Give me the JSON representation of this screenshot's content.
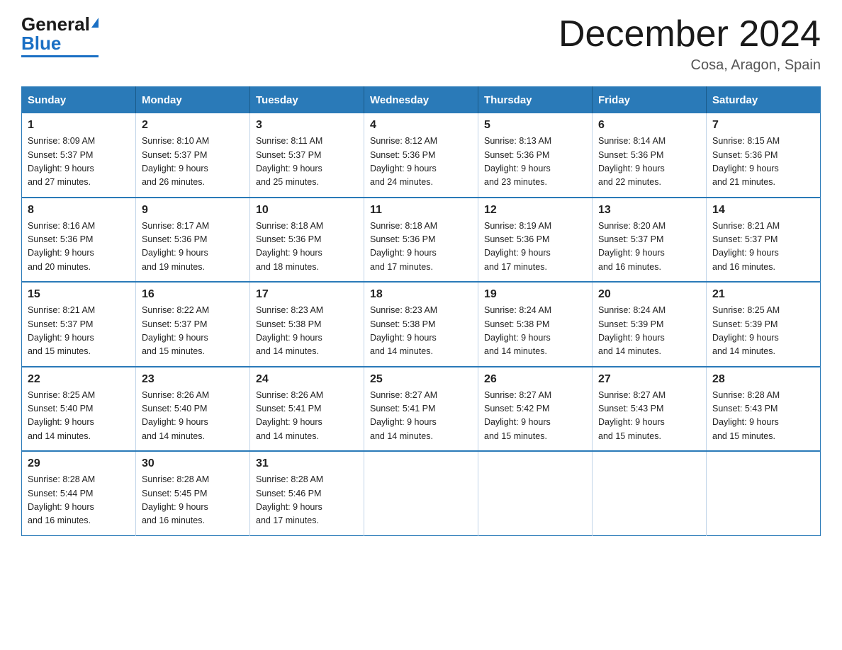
{
  "logo": {
    "general": "General",
    "blue": "Blue"
  },
  "title": "December 2024",
  "location": "Cosa, Aragon, Spain",
  "days_of_week": [
    "Sunday",
    "Monday",
    "Tuesday",
    "Wednesday",
    "Thursday",
    "Friday",
    "Saturday"
  ],
  "weeks": [
    [
      {
        "day": "1",
        "sunrise": "8:09 AM",
        "sunset": "5:37 PM",
        "daylight": "9 hours and 27 minutes."
      },
      {
        "day": "2",
        "sunrise": "8:10 AM",
        "sunset": "5:37 PM",
        "daylight": "9 hours and 26 minutes."
      },
      {
        "day": "3",
        "sunrise": "8:11 AM",
        "sunset": "5:37 PM",
        "daylight": "9 hours and 25 minutes."
      },
      {
        "day": "4",
        "sunrise": "8:12 AM",
        "sunset": "5:36 PM",
        "daylight": "9 hours and 24 minutes."
      },
      {
        "day": "5",
        "sunrise": "8:13 AM",
        "sunset": "5:36 PM",
        "daylight": "9 hours and 23 minutes."
      },
      {
        "day": "6",
        "sunrise": "8:14 AM",
        "sunset": "5:36 PM",
        "daylight": "9 hours and 22 minutes."
      },
      {
        "day": "7",
        "sunrise": "8:15 AM",
        "sunset": "5:36 PM",
        "daylight": "9 hours and 21 minutes."
      }
    ],
    [
      {
        "day": "8",
        "sunrise": "8:16 AM",
        "sunset": "5:36 PM",
        "daylight": "9 hours and 20 minutes."
      },
      {
        "day": "9",
        "sunrise": "8:17 AM",
        "sunset": "5:36 PM",
        "daylight": "9 hours and 19 minutes."
      },
      {
        "day": "10",
        "sunrise": "8:18 AM",
        "sunset": "5:36 PM",
        "daylight": "9 hours and 18 minutes."
      },
      {
        "day": "11",
        "sunrise": "8:18 AM",
        "sunset": "5:36 PM",
        "daylight": "9 hours and 17 minutes."
      },
      {
        "day": "12",
        "sunrise": "8:19 AM",
        "sunset": "5:36 PM",
        "daylight": "9 hours and 17 minutes."
      },
      {
        "day": "13",
        "sunrise": "8:20 AM",
        "sunset": "5:37 PM",
        "daylight": "9 hours and 16 minutes."
      },
      {
        "day": "14",
        "sunrise": "8:21 AM",
        "sunset": "5:37 PM",
        "daylight": "9 hours and 16 minutes."
      }
    ],
    [
      {
        "day": "15",
        "sunrise": "8:21 AM",
        "sunset": "5:37 PM",
        "daylight": "9 hours and 15 minutes."
      },
      {
        "day": "16",
        "sunrise": "8:22 AM",
        "sunset": "5:37 PM",
        "daylight": "9 hours and 15 minutes."
      },
      {
        "day": "17",
        "sunrise": "8:23 AM",
        "sunset": "5:38 PM",
        "daylight": "9 hours and 14 minutes."
      },
      {
        "day": "18",
        "sunrise": "8:23 AM",
        "sunset": "5:38 PM",
        "daylight": "9 hours and 14 minutes."
      },
      {
        "day": "19",
        "sunrise": "8:24 AM",
        "sunset": "5:38 PM",
        "daylight": "9 hours and 14 minutes."
      },
      {
        "day": "20",
        "sunrise": "8:24 AM",
        "sunset": "5:39 PM",
        "daylight": "9 hours and 14 minutes."
      },
      {
        "day": "21",
        "sunrise": "8:25 AM",
        "sunset": "5:39 PM",
        "daylight": "9 hours and 14 minutes."
      }
    ],
    [
      {
        "day": "22",
        "sunrise": "8:25 AM",
        "sunset": "5:40 PM",
        "daylight": "9 hours and 14 minutes."
      },
      {
        "day": "23",
        "sunrise": "8:26 AM",
        "sunset": "5:40 PM",
        "daylight": "9 hours and 14 minutes."
      },
      {
        "day": "24",
        "sunrise": "8:26 AM",
        "sunset": "5:41 PM",
        "daylight": "9 hours and 14 minutes."
      },
      {
        "day": "25",
        "sunrise": "8:27 AM",
        "sunset": "5:41 PM",
        "daylight": "9 hours and 14 minutes."
      },
      {
        "day": "26",
        "sunrise": "8:27 AM",
        "sunset": "5:42 PM",
        "daylight": "9 hours and 15 minutes."
      },
      {
        "day": "27",
        "sunrise": "8:27 AM",
        "sunset": "5:43 PM",
        "daylight": "9 hours and 15 minutes."
      },
      {
        "day": "28",
        "sunrise": "8:28 AM",
        "sunset": "5:43 PM",
        "daylight": "9 hours and 15 minutes."
      }
    ],
    [
      {
        "day": "29",
        "sunrise": "8:28 AM",
        "sunset": "5:44 PM",
        "daylight": "9 hours and 16 minutes."
      },
      {
        "day": "30",
        "sunrise": "8:28 AM",
        "sunset": "5:45 PM",
        "daylight": "9 hours and 16 minutes."
      },
      {
        "day": "31",
        "sunrise": "8:28 AM",
        "sunset": "5:46 PM",
        "daylight": "9 hours and 17 minutes."
      },
      null,
      null,
      null,
      null
    ]
  ]
}
